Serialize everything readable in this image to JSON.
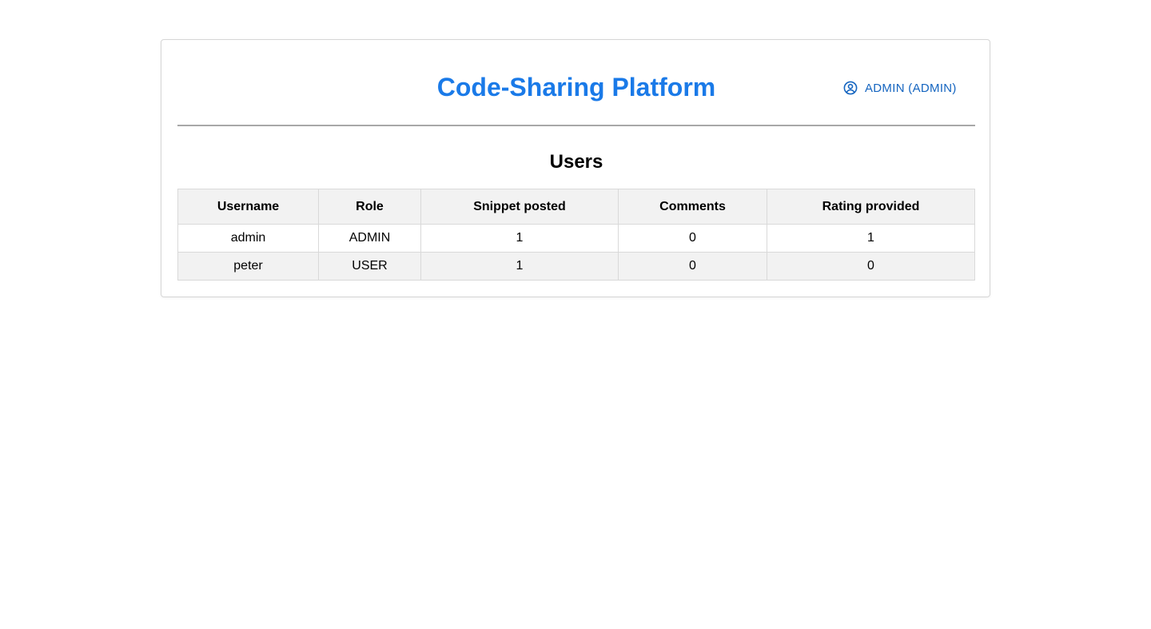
{
  "header": {
    "title": "Code-Sharing Platform",
    "user_icon": "user-circle-icon",
    "user_label": "ADMIN (ADMIN)"
  },
  "main": {
    "section_title": "Users",
    "table": {
      "columns": [
        "Username",
        "Role",
        "Snippet posted",
        "Comments",
        "Rating provided"
      ],
      "rows": [
        [
          "admin",
          "ADMIN",
          "1",
          "0",
          "1"
        ],
        [
          "peter",
          "USER",
          "1",
          "0",
          "0"
        ]
      ]
    }
  },
  "colors": {
    "accent": "#1a7ae8",
    "link": "#1565c0",
    "header_bg": "#f2f2f2",
    "border": "#d9d9d9"
  }
}
